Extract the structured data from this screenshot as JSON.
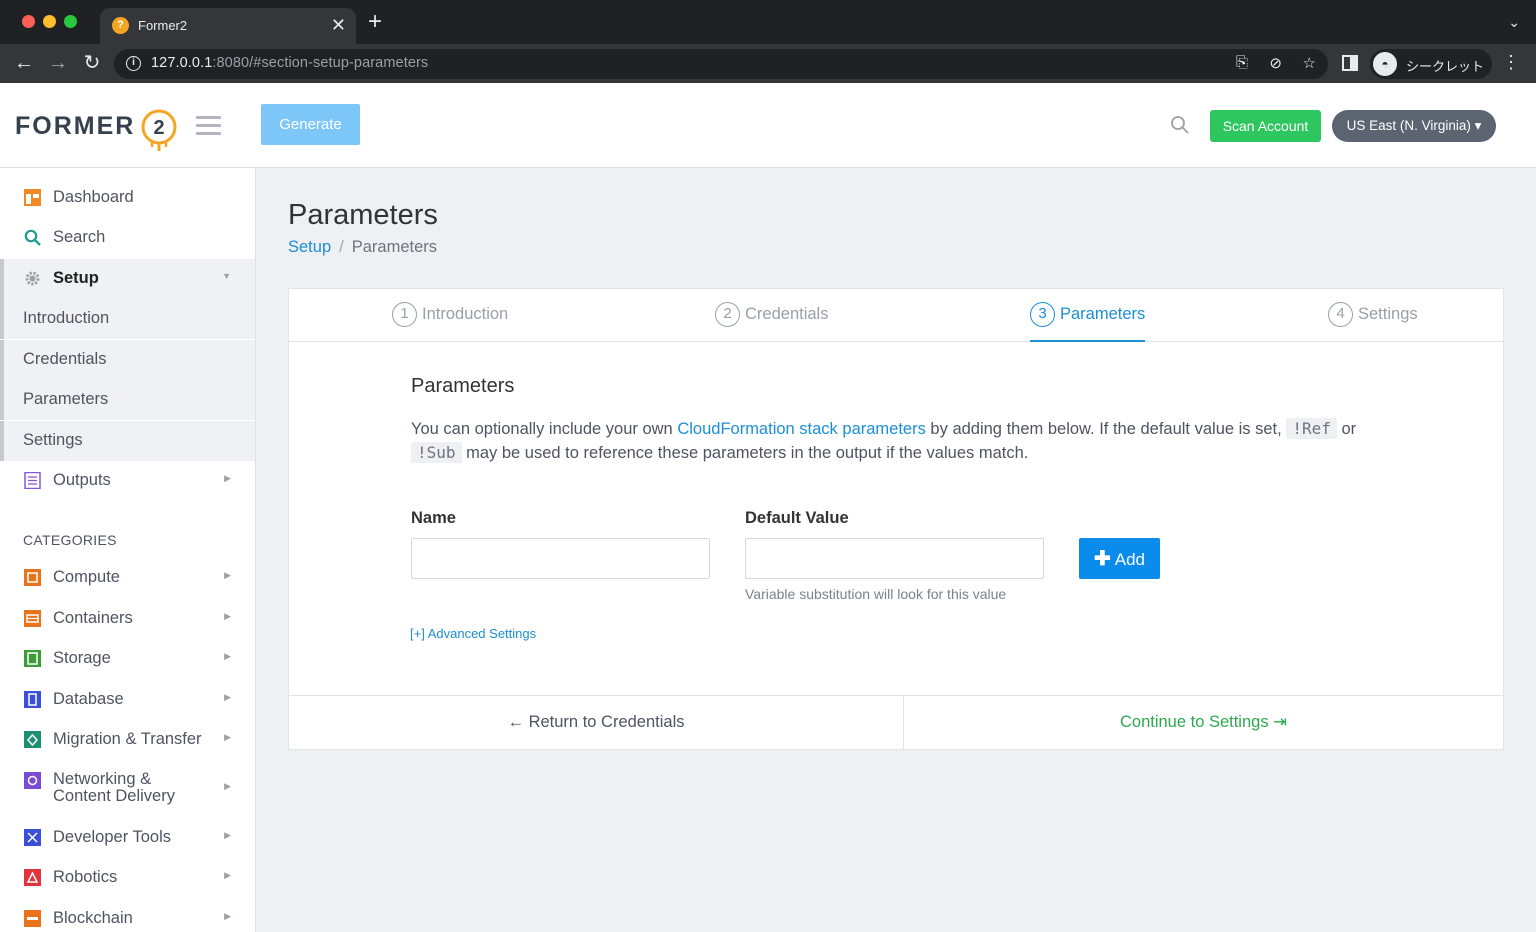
{
  "browser": {
    "tab_title": "Former2",
    "favicon_glyph": "?",
    "close_glyph": "✕",
    "newtab_glyph": "+",
    "tablist_glyph": "⌄",
    "url_host": "127.0.0.1",
    "url_rest": ":8080/#section-setup-parameters",
    "incognito_label": "シークレット",
    "nav_back": "←",
    "nav_forward": "→",
    "nav_reload": "↻",
    "info_glyph": "i",
    "translate_glyph": "⎘",
    "eye_off_glyph": "⊘",
    "star_glyph": "☆",
    "incognito_glyph": "◓",
    "menu_glyph": "⋮"
  },
  "header": {
    "logo_text": "FORMER",
    "logo_number": "2",
    "generate_label": "Generate",
    "scan_label": "Scan Account",
    "region_label": "US East (N. Virginia) ▾"
  },
  "sidebar": {
    "items": [
      {
        "label": "Dashboard",
        "icon": "dashboard-icon"
      },
      {
        "label": "Search",
        "icon": "search-icon"
      },
      {
        "label": "Setup",
        "icon": "gear-icon",
        "arrow": "▼"
      },
      {
        "label": "Introduction"
      },
      {
        "label": "Credentials"
      },
      {
        "label": "Parameters"
      },
      {
        "label": "Settings"
      },
      {
        "label": "Outputs",
        "icon": "document-icon",
        "arrow": "▶"
      }
    ],
    "categories_heading": "CATEGORIES",
    "categories": [
      {
        "label": "Compute",
        "color": "#e8731a",
        "arrow": "▶"
      },
      {
        "label": "Containers",
        "color": "#e8731a",
        "arrow": "▶"
      },
      {
        "label": "Storage",
        "color": "#3f9b3a",
        "arrow": "▶"
      },
      {
        "label": "Database",
        "color": "#3b4fd8",
        "arrow": "▶"
      },
      {
        "label": "Migration & Transfer",
        "color": "#1e8f72",
        "arrow": "▶"
      },
      {
        "label": "Networking &",
        "label2": "Content Delivery",
        "color": "#7b4bd1",
        "arrow": "▶"
      },
      {
        "label": "Developer Tools",
        "color": "#3b4fd8",
        "arrow": "▶"
      },
      {
        "label": "Robotics",
        "color": "#e0353c",
        "arrow": "▶"
      },
      {
        "label": "Blockchain",
        "color": "#e8731a",
        "arrow": "▶"
      }
    ]
  },
  "main": {
    "title": "Parameters",
    "breadcrumb_link": "Setup",
    "breadcrumb_sep": "/",
    "breadcrumb_current": "Parameters",
    "steps": [
      {
        "num": "1",
        "label": "Introduction"
      },
      {
        "num": "2",
        "label": "Credentials"
      },
      {
        "num": "3",
        "label": "Parameters",
        "active": true
      },
      {
        "num": "4",
        "label": "Settings"
      }
    ],
    "section_title": "Parameters",
    "desc_1": "You can optionally include your own ",
    "desc_link": "CloudFormation stack parameters",
    "desc_2": " by adding them below. If the default value is set, ",
    "code_ref": "!Ref",
    "desc_3": " or",
    "code_sub": "!Sub",
    "desc_4": " may be used to reference these parameters in the output if the values match.",
    "name_label": "Name",
    "name_value": "",
    "default_label": "Default Value",
    "default_value": "",
    "default_help": "Variable substitution will look for this value",
    "add_plus": "✚",
    "add_label": "Add",
    "advanced_link": "[+] Advanced Settings",
    "back_label": "← Return to Credentials",
    "continue_label": "Continue to Settings ⇥"
  },
  "colors": {
    "accent": "#1b8fd6",
    "scan_green": "#2ec75f",
    "generate_blue": "#7cc6f8",
    "add_blue": "#0a8cec",
    "continue_green": "#2ea84f",
    "logo_orange": "#f4a623"
  }
}
